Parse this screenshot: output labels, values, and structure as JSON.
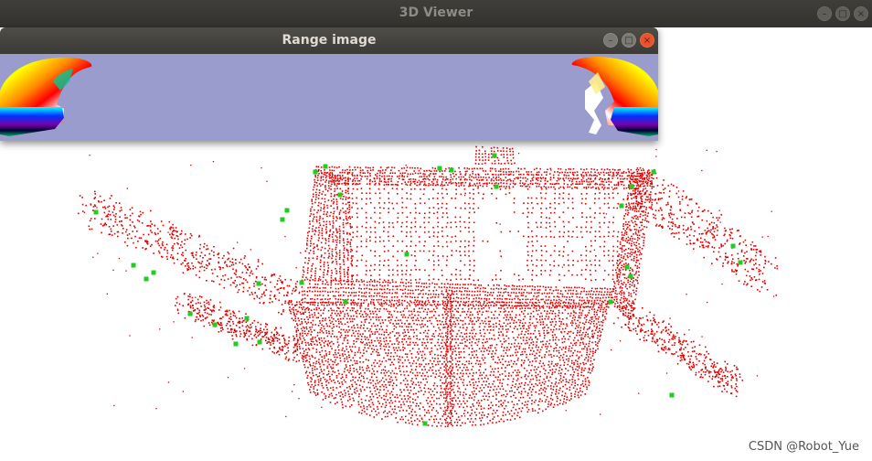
{
  "viewer_window": {
    "title": "3D Viewer",
    "controls": {
      "minimize": "–",
      "maximize": "□",
      "close": "×"
    },
    "background_color": "#ffffff",
    "point_color": "#e00000",
    "keypoint_color": "#22cc22"
  },
  "range_window": {
    "title": "Range image",
    "controls": {
      "minimize": "–",
      "maximize": "□",
      "close": "×"
    },
    "background_color": "#9a9ccd"
  },
  "watermark": "CSDN @Robot_Yue"
}
